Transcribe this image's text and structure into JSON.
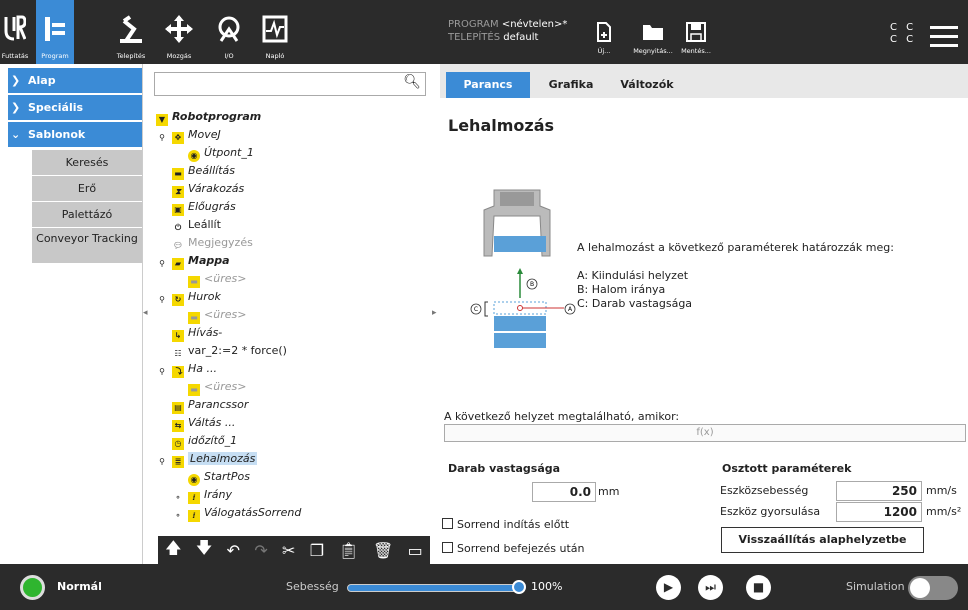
{
  "header": {
    "tabs": [
      {
        "label": "Futtatás",
        "icon": "ur-logo-icon"
      },
      {
        "label": "Program",
        "icon": "program-tree-icon"
      },
      {
        "label": "Telepítés",
        "icon": "robot-arm-icon"
      },
      {
        "label": "Mozgás",
        "icon": "move-arrows-icon"
      },
      {
        "label": "I/O",
        "icon": "io-icon"
      },
      {
        "label": "Napló",
        "icon": "log-chart-icon"
      }
    ],
    "program_key": "PROGRAM",
    "program_value": "<névtelen>*",
    "install_key": "TELEPÍTÉS",
    "install_value": "default",
    "file_buttons": [
      {
        "label": "Új...",
        "icon": "new-file-icon"
      },
      {
        "label": "Megnyitás...",
        "icon": "folder-icon"
      },
      {
        "label": "Mentés...",
        "icon": "save-icon"
      }
    ],
    "cc": [
      "C C",
      "C C"
    ]
  },
  "left_nav": {
    "categories": [
      "Alap",
      "Speciális",
      "Sablonok"
    ],
    "templates": [
      "Keresés",
      "Erő",
      "Palettázó",
      "Conveyor Tracking"
    ]
  },
  "tree": {
    "items": [
      {
        "label": "Robotprogram"
      },
      {
        "label": "MoveJ"
      },
      {
        "label": "Útpont_1"
      },
      {
        "label": "Beállítás"
      },
      {
        "label": "Várakozás"
      },
      {
        "label": "Előugrás"
      },
      {
        "label": "Leállít"
      },
      {
        "label": "Megjegyzés"
      },
      {
        "label": "Mappa"
      },
      {
        "label": "<üres>"
      },
      {
        "label": "Hurok"
      },
      {
        "label": "<üres>"
      },
      {
        "label": "Hívás-"
      },
      {
        "label": "var_2:=2 * force()"
      },
      {
        "label": "Ha ..."
      },
      {
        "label": "<üres>"
      },
      {
        "label": "Parancssor"
      },
      {
        "label": "Váltás ..."
      },
      {
        "label": "időzítő_1"
      },
      {
        "label": "Lehalmozás"
      },
      {
        "label": "StartPos"
      },
      {
        "label": "Irány"
      },
      {
        "label": "VálogatásSorrend"
      }
    ],
    "toolbar": [
      "move-up-icon",
      "move-down-icon",
      "undo-icon",
      "redo-icon",
      "cut-icon",
      "copy-icon",
      "paste-icon",
      "delete-icon",
      "suppress-icon"
    ]
  },
  "right": {
    "tabs": [
      "Parancs",
      "Grafika",
      "Változók"
    ],
    "title": "Lehalmozás",
    "desc_intro": "A lehalmozást a következő paraméterek határozzák meg:",
    "desc_a": "A: Kiindulási helyzet",
    "desc_b": "B: Halom iránya",
    "desc_c": "C: Darab vastagsága",
    "diagram_labels": {
      "a": "A",
      "b": "B",
      "c": "C"
    },
    "next_label": "A következő helyzet megtalálható, amikor:",
    "fx": "f(x)",
    "thickness_title": "Darab vastagsága",
    "thickness_value": "0.0",
    "thickness_unit": "mm",
    "cb_before": "Sorrend indítás előtt",
    "cb_after": "Sorrend befejezés után",
    "shared_title": "Osztott paraméterek",
    "tool_speed_label": "Eszközsebesség",
    "tool_speed_value": "250",
    "tool_speed_unit": "mm/s",
    "tool_acc_label": "Eszköz gyorsulása",
    "tool_acc_value": "1200",
    "tool_acc_unit": "mm/s²",
    "reset_label": "Visszaállítás alaphelyzetbe"
  },
  "footer": {
    "status": "Normál",
    "speed_label": "Sebesség",
    "speed_fraction": 1.0,
    "speed_pct": "100%",
    "sim_label": "Simulation",
    "status_color": "#2fb52f",
    "accent": "#3b8bd6"
  }
}
